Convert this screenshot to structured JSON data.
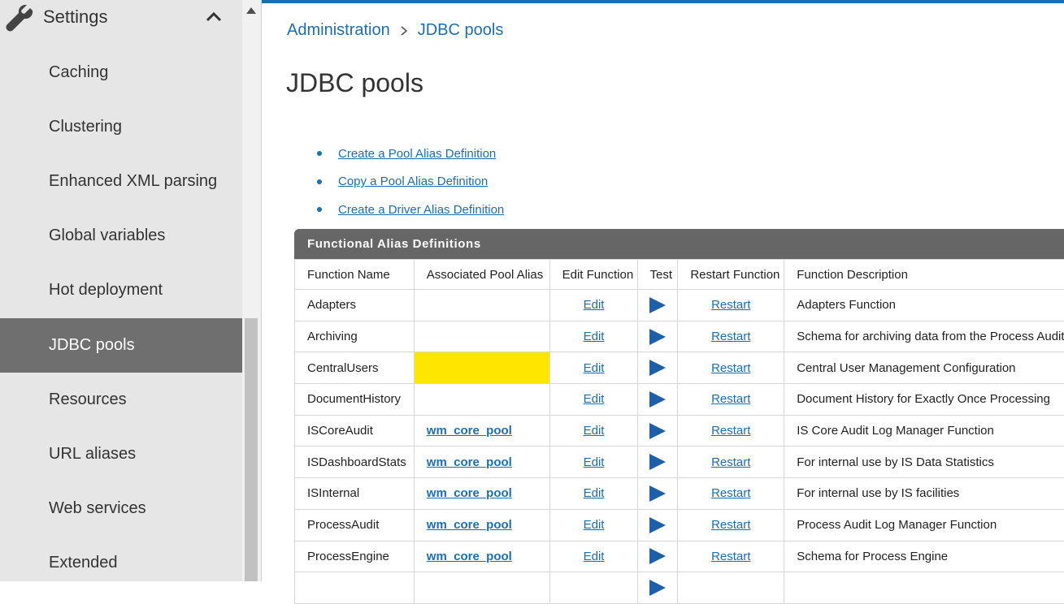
{
  "sidebar": {
    "title": "Settings",
    "items": [
      {
        "label": "Caching"
      },
      {
        "label": "Clustering"
      },
      {
        "label": "Enhanced XML parsing"
      },
      {
        "label": "Global variables"
      },
      {
        "label": "Hot deployment"
      },
      {
        "label": "JDBC pools",
        "active": true
      },
      {
        "label": "Resources"
      },
      {
        "label": "URL aliases"
      },
      {
        "label": "Web services"
      },
      {
        "label": "Extended"
      }
    ]
  },
  "breadcrumb": {
    "root": "Administration",
    "current": "JDBC pools"
  },
  "page_title": "JDBC pools",
  "links": [
    "Create a Pool Alias Definition",
    "Copy a Pool Alias Definition",
    "Create a Driver Alias Definition"
  ],
  "table": {
    "title": "Functional Alias Definitions",
    "columns": [
      "Function Name",
      "Associated Pool Alias",
      "Edit Function",
      "Test",
      "Restart Function",
      "Function Description"
    ],
    "rows": [
      {
        "name": "Adapters",
        "pool": "",
        "edit": "Edit",
        "restart": "Restart",
        "desc": "Adapters Function"
      },
      {
        "name": "Archiving",
        "pool": "",
        "edit": "Edit",
        "restart": "Restart",
        "desc": "Schema for archiving data from the Process Audit"
      },
      {
        "name": "CentralUsers",
        "pool": "",
        "edit": "Edit",
        "restart": "Restart",
        "desc": "Central User Management Configuration",
        "highlight": true
      },
      {
        "name": "DocumentHistory",
        "pool": "",
        "edit": "Edit",
        "restart": "Restart",
        "desc": "Document History for Exactly Once Processing"
      },
      {
        "name": "ISCoreAudit",
        "pool": "wm_core_pool",
        "edit": "Edit",
        "restart": "Restart",
        "desc": "IS Core Audit Log Manager Function"
      },
      {
        "name": "ISDashboardStats",
        "pool": "wm_core_pool",
        "edit": "Edit",
        "restart": "Restart",
        "desc": "For internal use by IS Data Statistics"
      },
      {
        "name": "ISInternal",
        "pool": "wm_core_pool",
        "edit": "Edit",
        "restart": "Restart",
        "desc": "For internal use by IS facilities"
      },
      {
        "name": "ProcessAudit",
        "pool": "wm_core_pool",
        "edit": "Edit",
        "restart": "Restart",
        "desc": "Process Audit Log Manager Function"
      },
      {
        "name": "ProcessEngine",
        "pool": "wm_core_pool",
        "edit": "Edit",
        "restart": "Restart",
        "desc": "Schema for Process Engine"
      }
    ]
  },
  "colors": {
    "accent": "#1a6fb3",
    "highlight": "#ffe600",
    "active_item": "#6f6f6f",
    "table_header": "#666666"
  },
  "icons": {
    "settings": "wrench-icon",
    "collapse": "chevron-up-icon",
    "breadcrumb_sep": "chevron-right-icon",
    "test": "play-icon"
  }
}
